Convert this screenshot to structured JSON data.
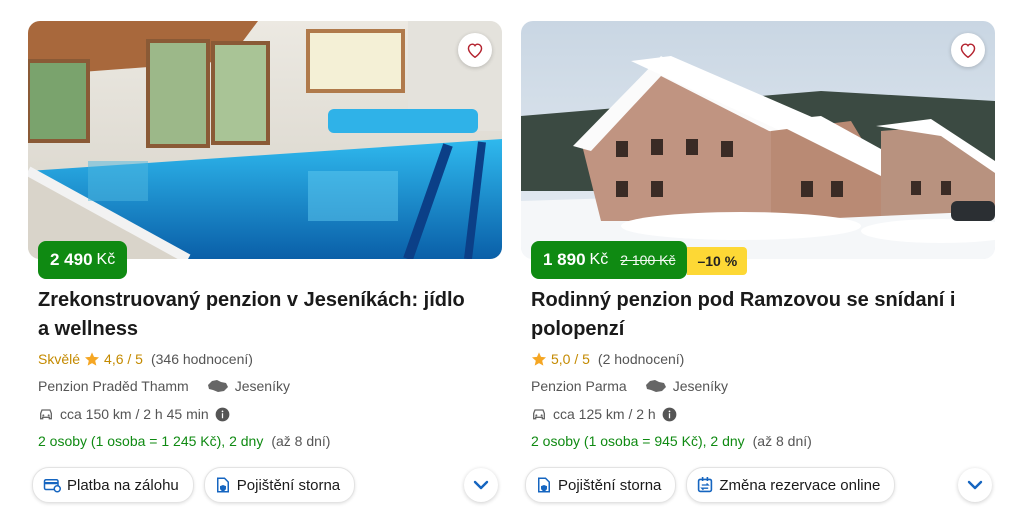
{
  "cards": [
    {
      "price": "2 490",
      "currency": "Kč",
      "title": "Zrekonstruovaný penzion v Jeseníkách: jídlo a wellness",
      "rating_word": "Skvělé",
      "rating": "4,6 / 5",
      "reviews": "(346 hodnocení)",
      "provider": "Penzion Praděd Thamm",
      "location": "Jeseníky",
      "distance": "cca 150 km / 2 h 45 min",
      "persons": "2 osoby (1 osoba = 1 245 Kč), 2 dny",
      "up_to": "(až 8 dní)",
      "chips": [
        {
          "icon": "card-icon",
          "label": "Platba na zálohu"
        },
        {
          "icon": "insurance-icon",
          "label": "Pojištění storna"
        }
      ]
    },
    {
      "price": "1 890",
      "currency": "Kč",
      "old_price": "2 100 Kč",
      "discount": "–10 %",
      "title": "Rodinný penzion pod Ramzovou se snídaní i polopenzí",
      "rating": "5,0 / 5",
      "reviews": "(2 hodnocení)",
      "provider": "Penzion Parma",
      "location": "Jeseníky",
      "distance": "cca 125 km / 2 h",
      "persons": "2 osoby (1 osoba = 945 Kč), 2 dny",
      "up_to": "(až 8 dní)",
      "chips": [
        {
          "icon": "insurance-icon",
          "label": "Pojištění storna"
        },
        {
          "icon": "calendar-change-icon",
          "label": "Změna rezervace online"
        }
      ]
    }
  ],
  "colors": {
    "price_green": "#0f8a12",
    "discount_yellow": "#fdd835",
    "rating_gold": "#c48a00",
    "accent_blue": "#1565c0",
    "heart_red": "#b4232f"
  }
}
